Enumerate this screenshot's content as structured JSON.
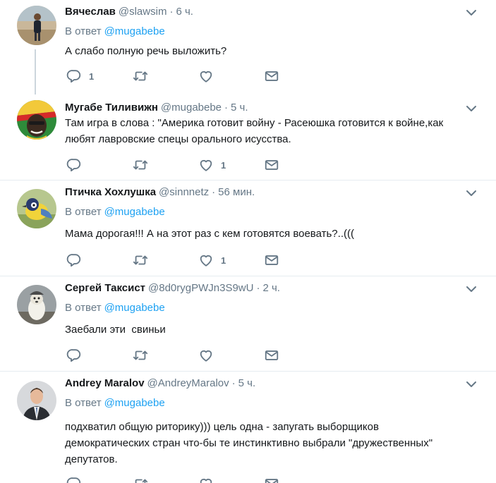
{
  "colors": {
    "accent": "#1da1f2",
    "muted": "#657786",
    "text": "#14171a",
    "divider": "#e6ecf0"
  },
  "reply_prefix": "В ответ",
  "tweets": [
    {
      "name": "Вячеслав",
      "handle": "@slawsim",
      "time": "6 ч.",
      "reply_to": "@mugabebe",
      "text": [
        "А слабо полную речь выложить?"
      ],
      "reply_count": "1",
      "retweet_count": "",
      "like_count": ""
    },
    {
      "name": "Мугабе Тиливижн",
      "handle": "@mugabebe",
      "time": "5 ч.",
      "reply_to": "",
      "text": [
        "Там игра в слова : \"Америка готовит войну - Расеюшка готовится к войне,как",
        "любят лавровские спецы орального исусства."
      ],
      "reply_count": "",
      "retweet_count": "",
      "like_count": "1"
    },
    {
      "name": "Птичка Хохлушка",
      "handle": "@sinnnetz",
      "time": "56 мин.",
      "reply_to": "@mugabebe",
      "text": [
        "Мама дорогая!!! А на этот раз с кем готовятся воевать?..((("
      ],
      "reply_count": "",
      "retweet_count": "",
      "like_count": "1"
    },
    {
      "name": "Сергей Таксист",
      "handle": "@8d0rygPWJn3S9wU",
      "time": "2 ч.",
      "reply_to": "@mugabebe",
      "text": [
        "Заебали эти  свиньи"
      ],
      "reply_count": "",
      "retweet_count": "",
      "like_count": ""
    },
    {
      "name": "Andrey Maralov",
      "handle": "@AndreyMaralov",
      "time": "5 ч.",
      "reply_to": "@mugabebe",
      "text": [
        "подхватил общую риторику))) цель одна - запугать выборщиков",
        "демократических стран что-бы те инстинктивно выбрали \"дружественных\"",
        "депутатов."
      ],
      "reply_count": "",
      "retweet_count": "",
      "like_count": ""
    }
  ]
}
